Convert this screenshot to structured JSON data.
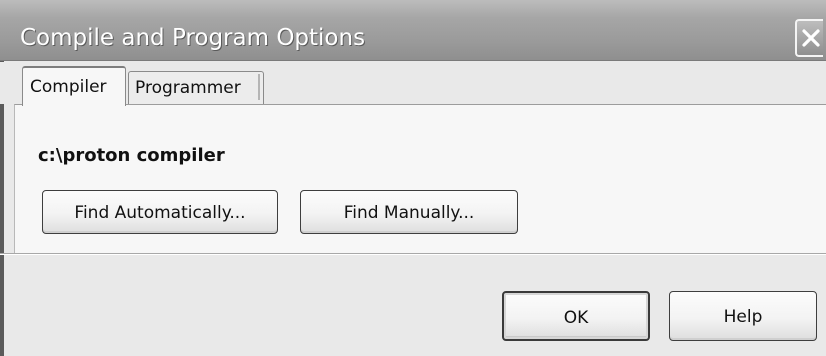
{
  "window": {
    "title": "Compile and Program Options"
  },
  "tabs": [
    {
      "label": "Compiler",
      "selected": true
    },
    {
      "label": "Programmer",
      "selected": false
    }
  ],
  "compiler_tab": {
    "path": "c:\\proton compiler",
    "find_automatically_label": "Find Automatically...",
    "find_manually_label": "Find Manually..."
  },
  "footer": {
    "ok_label": "OK",
    "help_label": "Help"
  }
}
